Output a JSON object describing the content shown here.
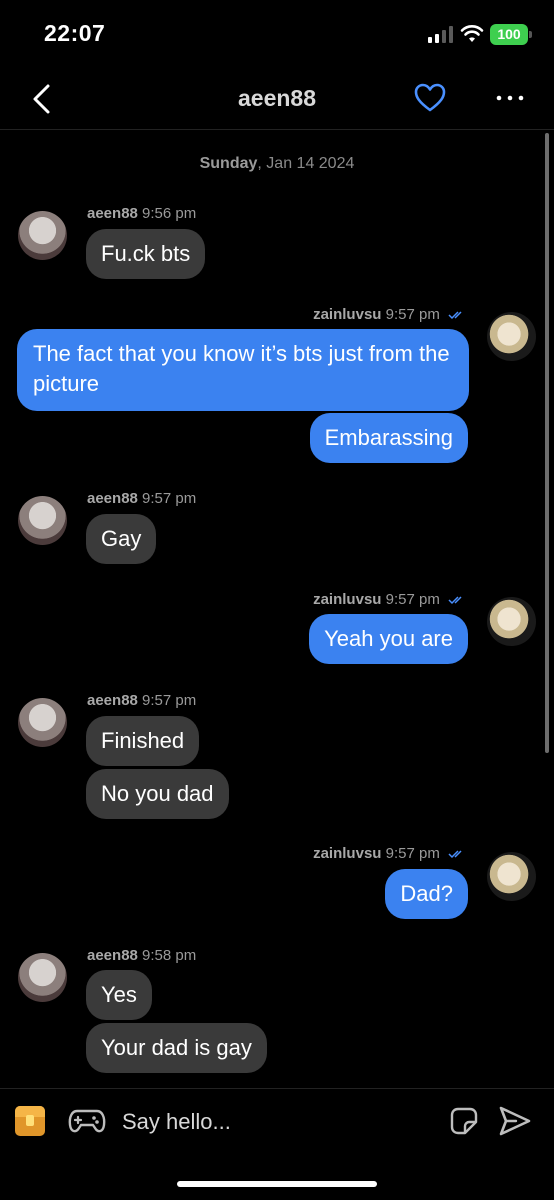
{
  "status_bar": {
    "time": "22:07",
    "battery": "100"
  },
  "nav": {
    "title": "aeen88",
    "back_icon": "chevron-left-icon",
    "heart_icon": "heart-icon",
    "more_icon": "more-dots-icon"
  },
  "date_separator": {
    "day": "Sunday",
    "date": ", Jan 14 2024"
  },
  "messages": [
    {
      "sender": "aeen88",
      "time": "9:56 pm",
      "texts": [
        "Fu.ck bts"
      ]
    },
    {
      "sender": "zainluvsu",
      "time": "9:57 pm",
      "texts": [
        "The fact that you know it’s bts just from the picture",
        "Embarassing"
      ]
    },
    {
      "sender": "aeen88",
      "time": "9:57 pm",
      "texts": [
        "Gay"
      ]
    },
    {
      "sender": "zainluvsu",
      "time": "9:57 pm",
      "texts": [
        "Yeah you are"
      ]
    },
    {
      "sender": "aeen88",
      "time": "9:57 pm",
      "texts": [
        "Finished",
        "No you dad"
      ]
    },
    {
      "sender": "zainluvsu",
      "time": "9:57 pm",
      "texts": [
        "Dad?"
      ]
    },
    {
      "sender": "aeen88",
      "time": "9:58 pm",
      "texts": [
        "Yes",
        "Your dad is gay"
      ]
    }
  ],
  "composer": {
    "placeholder": "Say hello...",
    "icons": [
      "chest-icon",
      "gamepad-icon",
      "sticker-icon",
      "send-icon"
    ]
  },
  "colors": {
    "outgoing_bubble": "#3b82f0",
    "incoming_bubble": "#3a3a3a",
    "accent": "#4a90ff",
    "battery": "#3ecf4f"
  }
}
